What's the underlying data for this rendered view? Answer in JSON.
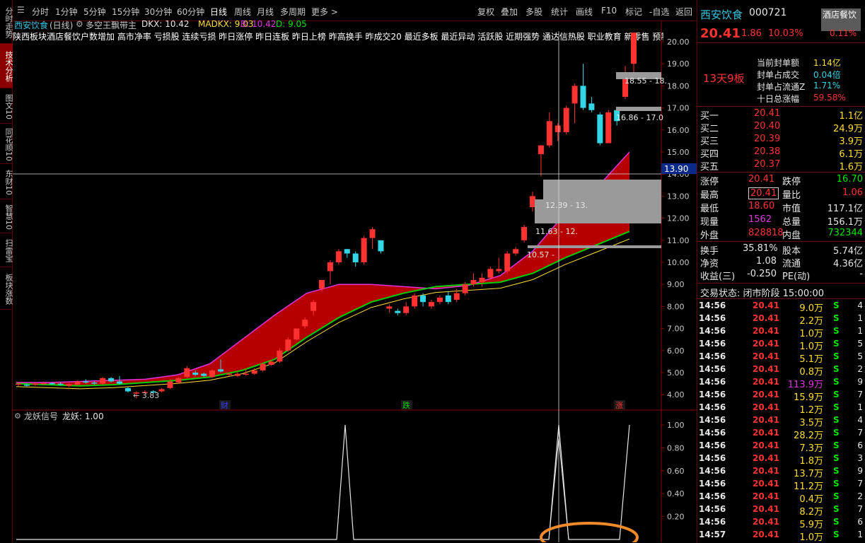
{
  "leftbar": [
    {
      "label": "分时走势",
      "active": false
    },
    {
      "label": "技术分析",
      "active": true
    },
    {
      "label": "图文10",
      "active": false
    },
    {
      "label": "同花顺10",
      "active": false
    },
    {
      "label": "东财10",
      "active": false
    },
    {
      "label": "智慧10",
      "active": false
    },
    {
      "label": "扫雷宝",
      "active": false
    },
    {
      "label": "板块涨数",
      "active": false
    }
  ],
  "periods": [
    "分时",
    "1分钟",
    "5分钟",
    "15分钟",
    "30分钟",
    "60分钟",
    "日线",
    "周线",
    "月线",
    "多周期",
    "更多 >"
  ],
  "active_period": "日线",
  "tools": [
    "复权",
    "叠加",
    "多股",
    "统计",
    "画线",
    "F10",
    "标记",
    "-自选",
    "返回"
  ],
  "title": {
    "stock": "西安饮食",
    "period": "(日线)",
    "indicator": "多空王飘带主",
    "dkx": "DKX: 10.42",
    "madkx": "MADKX: 9.03",
    "b": "B: 10.42",
    "d": "D: 9.05"
  },
  "sectors": "陕西板块酒店餐饮户数增加 高市净率 亏损股 连续亏损 昨日涨停 昨日连板 昨日上榜 昨高换手 昨成交20 最近多板 最近异动 活跃股 近期强势 通达信热股 职业教育 新零售 预制菜",
  "price_axis": [
    "20.00",
    "19.00",
    "18.00",
    "17.00",
    "16.00",
    "15.00",
    "14.00",
    "13.00",
    "12.00",
    "11.00",
    "10.00",
    "9.00",
    "8.00",
    "7.00",
    "6.00",
    "5.00",
    "4.00"
  ],
  "crosshair_price": "13.90",
  "chip_labels": [
    "18.55 - 18.",
    "16.86 - 17.0",
    "12.39 - 13.",
    "11.63 - 12.",
    "10.57 -"
  ],
  "min_label": "3.83",
  "event_marks": [
    "财",
    "跌",
    "涨"
  ],
  "sub": {
    "title": "龙妖信号",
    "value": "龙妖: 1.00",
    "axis": [
      "1.00",
      "0.80",
      "0.60",
      "0.40",
      "0.20"
    ]
  },
  "chart_data": {
    "type": "line",
    "title": "龙妖信号",
    "series": [
      {
        "name": "龙妖",
        "values": [
          0,
          0,
          0,
          0,
          0,
          0,
          0,
          0,
          1,
          0,
          0,
          0,
          0,
          0,
          0,
          0,
          0,
          0,
          0,
          0,
          1,
          0,
          0,
          0,
          1
        ]
      }
    ],
    "ylim": [
      0,
      1
    ]
  },
  "right": {
    "name": "西安饮食",
    "code": "000721",
    "tag": "酒店餐饮",
    "price": "20.41",
    "change": "1.86",
    "pct": "10.03%",
    "small_pct": "0.11%",
    "streak": "13天9板",
    "info": [
      [
        "当前封单额",
        "1.14亿"
      ],
      [
        "封单占成交",
        "0.04倍"
      ],
      [
        "封单占流通Z",
        "1.71%"
      ],
      [
        "十日总涨幅",
        "59.58%"
      ]
    ],
    "asks": [
      [
        "买一",
        "20.41",
        "1.1亿"
      ],
      [
        "买二",
        "20.40",
        "24.9万"
      ],
      [
        "买三",
        "20.39",
        "3.9万"
      ],
      [
        "买四",
        "20.38",
        "6.1万"
      ],
      [
        "买五",
        "20.37",
        "1.6万"
      ]
    ],
    "quote": [
      [
        "涨停",
        "20.41",
        "跌停",
        "16.70"
      ],
      [
        "最高",
        "20.41",
        "量比",
        "1.06"
      ],
      [
        "最低",
        "18.60",
        "市值",
        "117.1亿"
      ],
      [
        "现量",
        "1562",
        "总量",
        "156.1万"
      ],
      [
        "外盘",
        "828818",
        "内盘",
        "732344"
      ]
    ],
    "quote2": [
      [
        "换手",
        "35.81%",
        "股本",
        "5.74亿"
      ],
      [
        "净资",
        "1.08",
        "流通",
        "4.36亿"
      ],
      [
        "收益(三)",
        "-0.250",
        "PE(动)",
        "-"
      ]
    ],
    "status": "交易状态: 闭市阶段 15:00:00",
    "ticks": [
      [
        "14:56",
        "20.41",
        "9.0万",
        "S",
        "4"
      ],
      [
        "14:56",
        "20.41",
        "2.2万",
        "S",
        "1"
      ],
      [
        "14:56",
        "20.41",
        "1.0万",
        "S",
        "1"
      ],
      [
        "14:56",
        "20.41",
        "1.0万",
        "S",
        "5"
      ],
      [
        "14:56",
        "20.41",
        "5.1万",
        "S",
        "5"
      ],
      [
        "14:56",
        "20.41",
        "0.8万",
        "S",
        "2"
      ],
      [
        "14:56",
        "20.41",
        "113.9万",
        "S",
        "9"
      ],
      [
        "14:56",
        "20.41",
        "15.9万",
        "S",
        "7"
      ],
      [
        "14:56",
        "20.41",
        "1.2万",
        "S",
        "1"
      ],
      [
        "14:56",
        "20.41",
        "3.5万",
        "S",
        "4"
      ],
      [
        "14:56",
        "20.41",
        "28.2万",
        "S",
        "7"
      ],
      [
        "14:56",
        "20.41",
        "7.3万",
        "S",
        "6"
      ],
      [
        "14:56",
        "20.41",
        "1.8万",
        "S",
        "3"
      ],
      [
        "14:56",
        "20.41",
        "13.7万",
        "S",
        "9"
      ],
      [
        "14:56",
        "20.41",
        "11.2万",
        "S",
        "7"
      ],
      [
        "14:56",
        "20.41",
        "0.4万",
        "S",
        "2"
      ],
      [
        "14:56",
        "20.41",
        "8.2万",
        "S",
        "7"
      ],
      [
        "14:56",
        "20.41",
        "5.9万",
        "S",
        "6"
      ],
      [
        "14:57",
        "20.41",
        "1.0万",
        "S",
        "1"
      ]
    ]
  }
}
